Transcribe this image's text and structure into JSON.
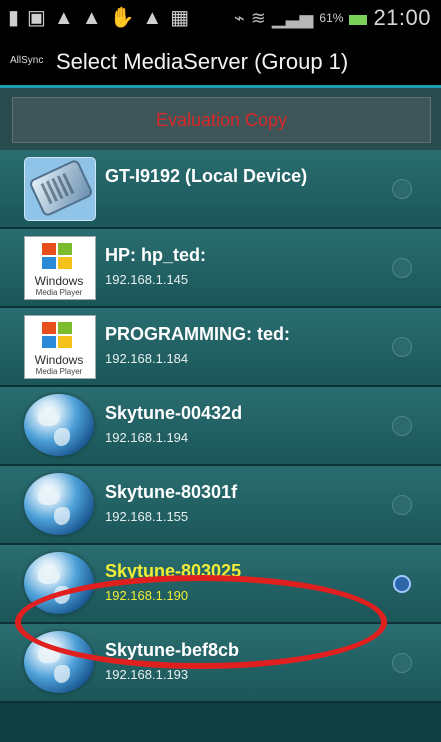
{
  "status_bar": {
    "left_icons": [
      "sd-card-icon",
      "gallery-icon",
      "warning-icon",
      "warning-icon",
      "gesture-icon",
      "warning-icon",
      "image-icon"
    ],
    "right_icons": [
      "vibrate-icon",
      "wifi-icon",
      "signal-icon"
    ],
    "battery_percent": "61%",
    "time": "21:00"
  },
  "header": {
    "brand": "AllSync",
    "title": "Select MediaServer (Group 1)"
  },
  "banner": {
    "text": "Evaluation Copy"
  },
  "devices": [
    {
      "name": "GT-I9192 (Local Device)",
      "ip": "",
      "icon": "phone-icon",
      "selected": false
    },
    {
      "name": "HP: hp_ted:",
      "ip": "192.168.1.145",
      "icon": "windows-media-player-icon",
      "selected": false
    },
    {
      "name": "PROGRAMMING: ted:",
      "ip": "192.168.1.184",
      "icon": "windows-media-player-icon",
      "selected": false
    },
    {
      "name": "Skytune-00432d",
      "ip": "192.168.1.194",
      "icon": "globe-icon",
      "selected": false
    },
    {
      "name": "Skytune-80301f",
      "ip": "192.168.1.155",
      "icon": "globe-icon",
      "selected": false
    },
    {
      "name": "Skytune-803025",
      "ip": "192.168.1.190",
      "icon": "globe-icon",
      "selected": true
    },
    {
      "name": "Skytune-bef8cb",
      "ip": "192.168.1.193",
      "icon": "globe-icon",
      "selected": false
    }
  ],
  "wmp_logo": {
    "line1": "Windows",
    "line2": "Media Player"
  },
  "colors": {
    "accent": "#1d9fb0",
    "selected_text": "#f1ee36",
    "eval_text": "#d8282a",
    "highlight": "#e0201f"
  }
}
